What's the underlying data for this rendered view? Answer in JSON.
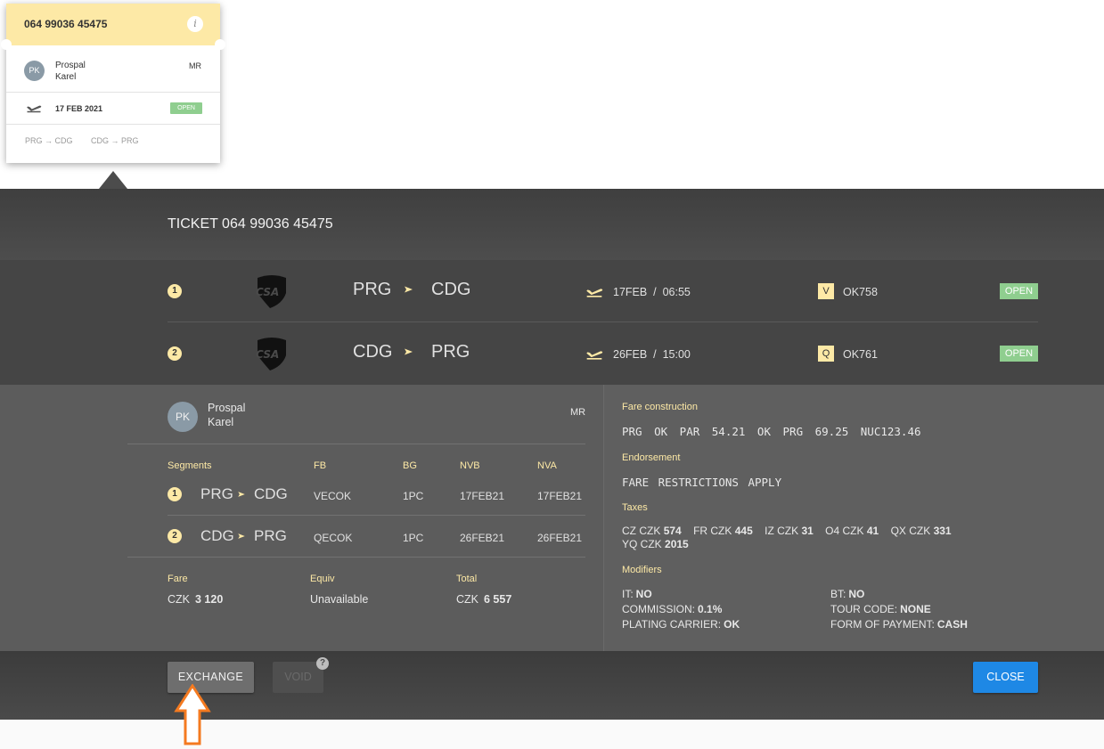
{
  "card": {
    "ticket_number": "064 99036 45475",
    "info_icon": "i",
    "avatar_initials": "PK",
    "name_line1": "Prospal",
    "name_line2": "Karel",
    "title": "MR",
    "date": "17 FEB 2021",
    "status": "OPEN",
    "routes": [
      "PRG → CDG",
      "CDG → PRG"
    ]
  },
  "dialog": {
    "title": "TICKET 064 99036 45475",
    "segments": [
      {
        "num": "1",
        "from": "PRG",
        "to": "CDG",
        "date": "17FEB",
        "time": "06:55",
        "datetime": "17FEB  /  06:55",
        "class": "V",
        "flight": "OK758",
        "status": "OPEN"
      },
      {
        "num": "2",
        "from": "CDG",
        "to": "PRG",
        "date": "26FEB",
        "time": "15:00",
        "datetime": "26FEB  /  15:00",
        "class": "Q",
        "flight": "OK761",
        "status": "OPEN"
      }
    ],
    "passenger": {
      "initials": "PK",
      "first": "Prospal",
      "last": "Karel",
      "title": "MR"
    },
    "fare_table": {
      "headers": [
        "Segments",
        "FB",
        "BG",
        "NVB",
        "NVA"
      ],
      "rows": [
        {
          "num": "1",
          "from": "PRG",
          "to": "CDG",
          "fb": "VECOK",
          "bg": "1PC",
          "nvb": "17FEB21",
          "nva": "17FEB21"
        },
        {
          "num": "2",
          "from": "CDG",
          "to": "PRG",
          "fb": "QECOK",
          "bg": "1PC",
          "nvb": "26FEB21",
          "nva": "26FEB21"
        }
      ]
    },
    "summary": {
      "fare_label": "Fare",
      "fare_currency": "CZK",
      "fare_value": "3 120",
      "equiv_label": "Equiv",
      "equiv_value": "Unavailable",
      "total_label": "Total",
      "total_currency": "CZK",
      "total_value": "6 557"
    },
    "fare_construction_label": "Fare construction",
    "fare_construction": "PRG OK PAR 54.21 OK PRG 69.25 NUC123.46",
    "endorsement_label": "Endorsement",
    "endorsement": "FARE RESTRICTIONS APPLY",
    "taxes_label": "Taxes",
    "taxes": [
      {
        "code": "CZ CZK",
        "amount": "574"
      },
      {
        "code": "FR CZK",
        "amount": "445"
      },
      {
        "code": "IZ CZK",
        "amount": "31"
      },
      {
        "code": "O4 CZK",
        "amount": "41"
      },
      {
        "code": "QX CZK",
        "amount": "331"
      },
      {
        "code": "YQ CZK",
        "amount": "2015"
      }
    ],
    "modifiers_label": "Modifiers",
    "modifiers": {
      "it_label": "IT:",
      "it_value": "NO",
      "commission_label": "COMMISSION:",
      "commission_value": "0.1%",
      "plating_label": "PLATING CARRIER:",
      "plating_value": "OK",
      "bt_label": "BT:",
      "bt_value": "NO",
      "tour_label": "TOUR CODE:",
      "tour_value": "NONE",
      "fop_label": "FORM OF PAYMENT:",
      "fop_value": "CASH"
    },
    "buttons": {
      "exchange": "EXCHANGE",
      "void": "VOID",
      "help": "?",
      "close": "CLOSE"
    }
  },
  "colors": {
    "accent_yellow": "#fde9a6",
    "status_green": "#8fce8f",
    "close_blue": "#1e88e5",
    "hint_arrow": "#f47a20"
  }
}
